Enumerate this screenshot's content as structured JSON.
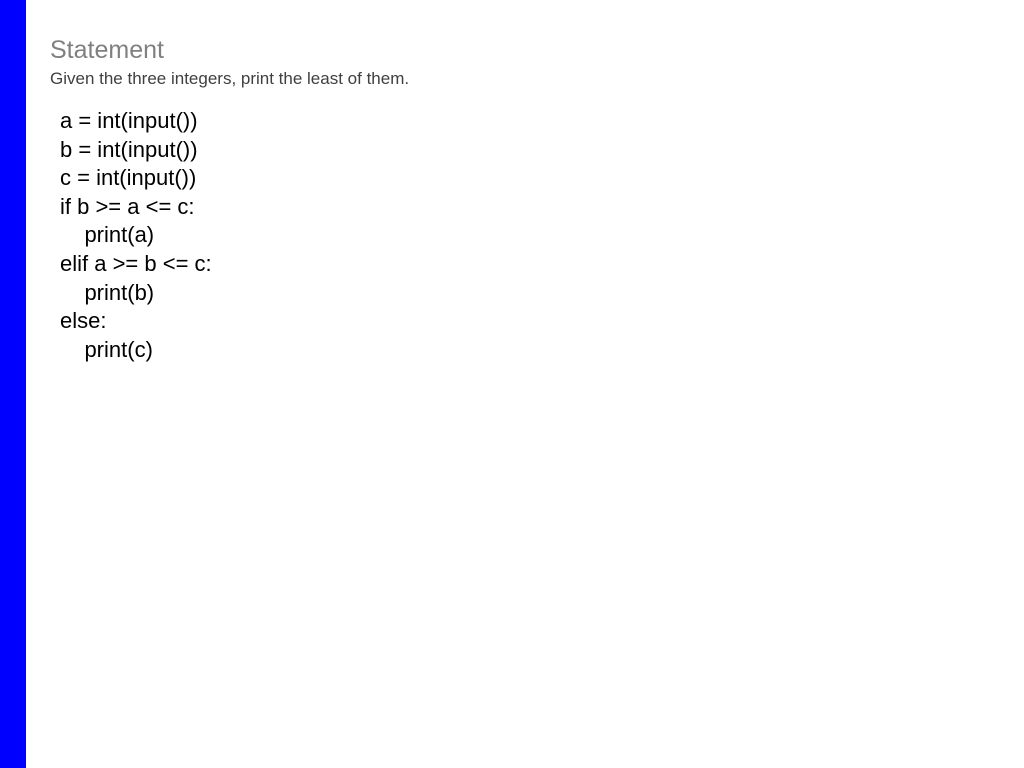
{
  "heading": "Statement",
  "description": "Given the three integers, print the least of them.",
  "code": "a = int(input())\nb = int(input())\nc = int(input())\nif b >= a <= c:\n    print(a)\nelif a >= b <= c:\n    print(b)\nelse:\n    print(c)"
}
